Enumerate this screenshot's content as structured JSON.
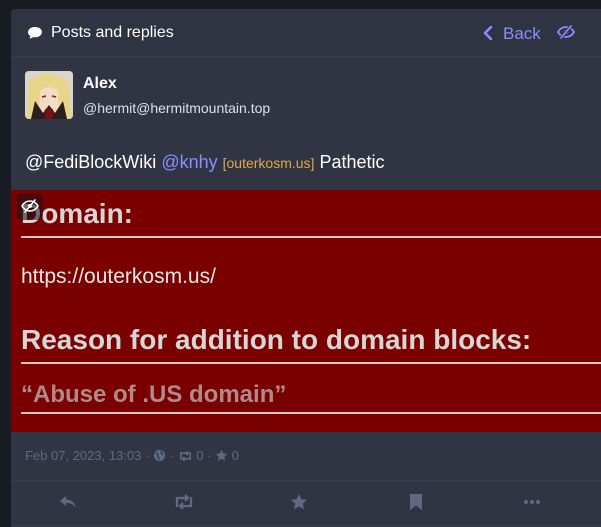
{
  "header": {
    "title": "Posts and replies",
    "back_label": "Back"
  },
  "post": {
    "display_name": "Alex",
    "acct": "@hermit@hermitmountain.top",
    "content": {
      "mention1": "@FediBlockWiki",
      "mention2": "@knhy",
      "tag": "[outerkosm.us]",
      "text": "Pathetic"
    },
    "media": {
      "heading1": "Domain:",
      "url": "https://outerkosm.us/",
      "heading2": "Reason for addition to domain blocks:",
      "quote": "“Abuse of .US domain”"
    },
    "meta": {
      "date": "Feb 07, 2023, 13:03",
      "separator": "·",
      "boosts": "0",
      "favourites": "0"
    }
  },
  "colors": {
    "accent": "#8c8dff",
    "column_bg": "#313543",
    "media_bg": "#7a0000",
    "muted": "#606984"
  },
  "icons": {
    "header": "speech-bubble-icon",
    "back": "chevron-left-icon",
    "visibility": "eye-slash-icon",
    "actions": [
      "reply-icon",
      "boost-icon",
      "star-icon",
      "bookmark-icon",
      "ellipsis-icon"
    ]
  }
}
